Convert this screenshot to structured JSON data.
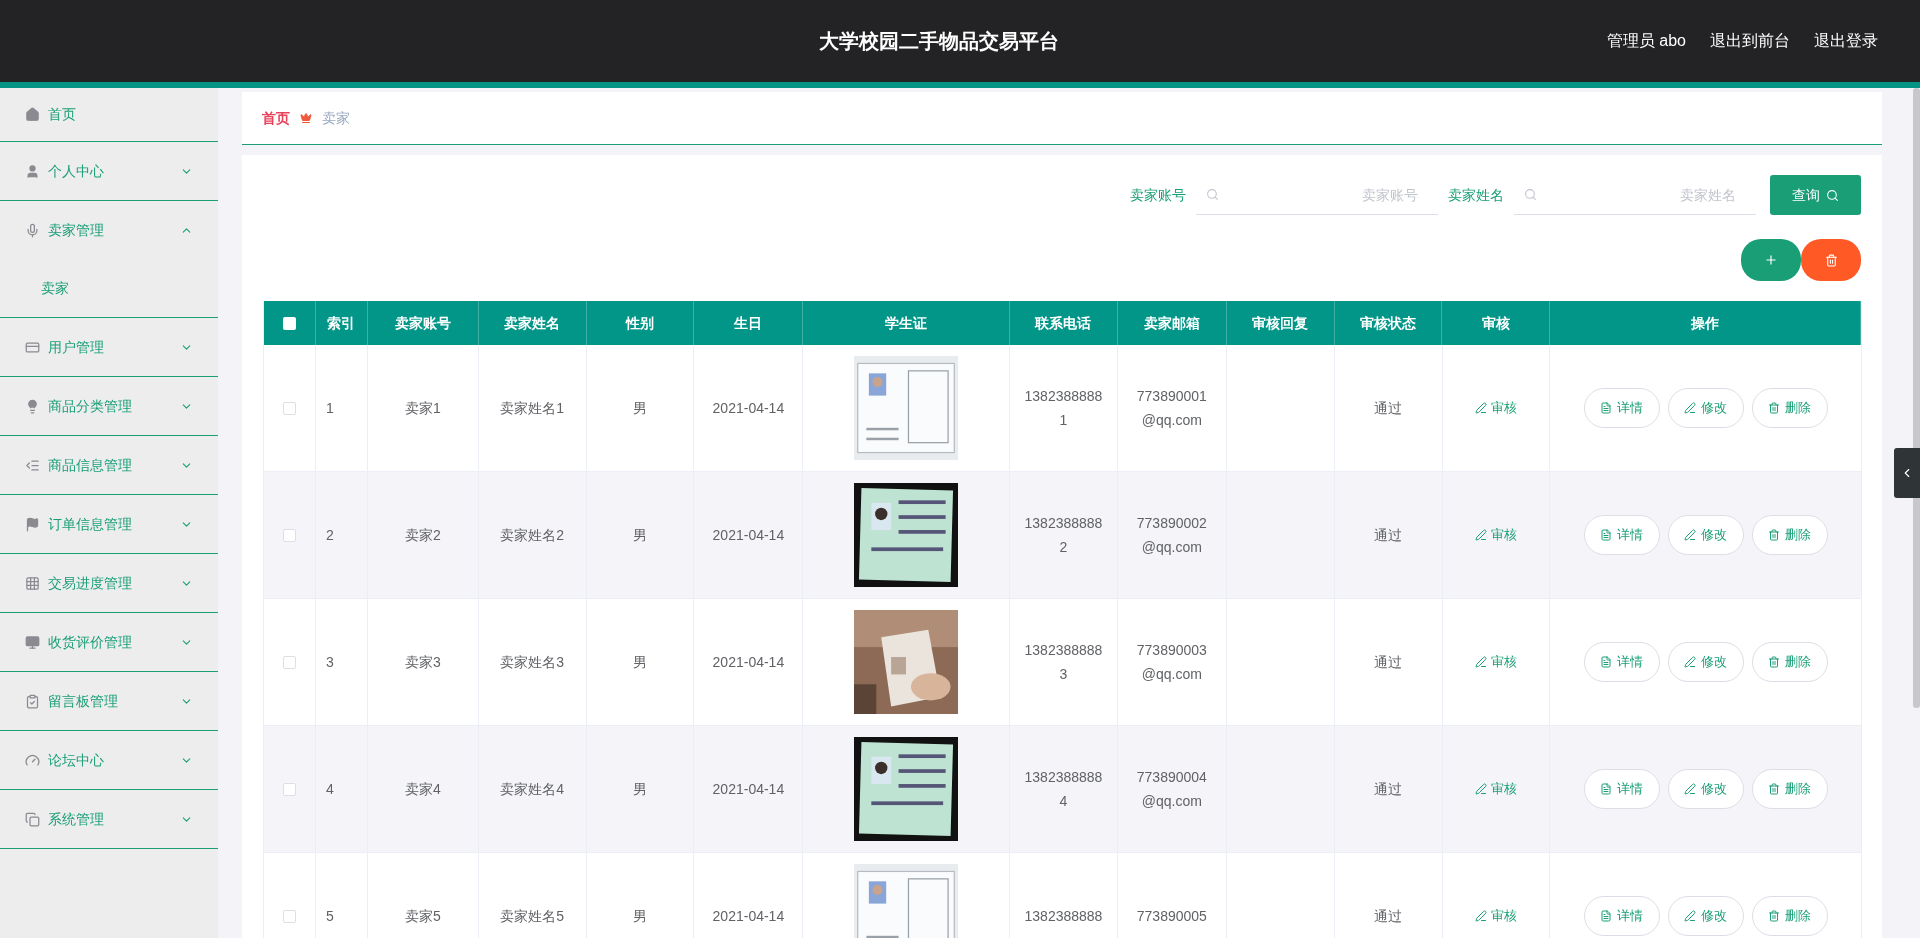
{
  "header": {
    "title": "大学校园二手物品交易平台",
    "user": "管理员 abo",
    "links": [
      "退出到前台",
      "退出登录"
    ]
  },
  "sidebar": {
    "items": [
      {
        "label": "首页",
        "kind": "link"
      },
      {
        "label": "个人中心",
        "kind": "menu",
        "expanded": false
      },
      {
        "label": "卖家管理",
        "kind": "menu",
        "expanded": true,
        "children": [
          {
            "label": "卖家"
          }
        ]
      },
      {
        "label": "用户管理",
        "kind": "menu",
        "expanded": false
      },
      {
        "label": "商品分类管理",
        "kind": "menu",
        "expanded": false
      },
      {
        "label": "商品信息管理",
        "kind": "menu",
        "expanded": false
      },
      {
        "label": "订单信息管理",
        "kind": "menu",
        "expanded": false
      },
      {
        "label": "交易进度管理",
        "kind": "menu",
        "expanded": false
      },
      {
        "label": "收货评价管理",
        "kind": "menu",
        "expanded": false
      },
      {
        "label": "留言板管理",
        "kind": "menu",
        "expanded": false
      },
      {
        "label": "论坛中心",
        "kind": "menu",
        "expanded": false
      },
      {
        "label": "系统管理",
        "kind": "menu",
        "expanded": false
      }
    ]
  },
  "breadcrumb": [
    "首页",
    "卖家"
  ],
  "search": {
    "fields": [
      {
        "label": "卖家账号",
        "placeholder": "卖家账号"
      },
      {
        "label": "卖家姓名",
        "placeholder": "卖家姓名"
      }
    ],
    "button": "查询"
  },
  "table": {
    "select_all": {
      "checked": false
    },
    "columns": [
      "索引",
      "卖家账号",
      "卖家姓名",
      "性别",
      "生日",
      "学生证",
      "联系电话",
      "卖家邮箱",
      "审核回复",
      "审核状态",
      "审核",
      "操作"
    ],
    "rows": [
      {
        "checked": false,
        "index": "1",
        "account": "卖家1",
        "name": "卖家姓名1",
        "gender": "男",
        "birthday": "2021-04-14",
        "phone": "13823888881",
        "email": "773890001@qq.com",
        "status": "通过",
        "review": "审核",
        "actions": [
          "详情",
          "修改",
          "删除"
        ]
      },
      {
        "checked": false,
        "index": "2",
        "account": "卖家2",
        "name": "卖家姓名2",
        "gender": "男",
        "birthday": "2021-04-14",
        "phone": "13823888882",
        "email": "773890002@qq.com",
        "status": "通过",
        "review": "审核",
        "actions": [
          "详情",
          "修改",
          "删除"
        ]
      },
      {
        "checked": false,
        "index": "3",
        "account": "卖家3",
        "name": "卖家姓名3",
        "gender": "男",
        "birthday": "2021-04-14",
        "phone": "13823888883",
        "email": "773890003@qq.com",
        "status": "通过",
        "review": "审核",
        "actions": [
          "详情",
          "修改",
          "删除"
        ]
      },
      {
        "checked": false,
        "index": "4",
        "account": "卖家4",
        "name": "卖家姓名4",
        "gender": "男",
        "birthday": "2021-04-14",
        "phone": "13823888884",
        "email": "773890004@qq.com",
        "status": "通过",
        "review": "审核",
        "actions": [
          "详情",
          "修改",
          "删除"
        ]
      },
      {
        "checked": false,
        "index": "5",
        "account": "卖家5",
        "name": "卖家姓名5",
        "gender": "男",
        "birthday": "2021-04-14",
        "phone": "1382388888",
        "email": "773890005",
        "status": "通过",
        "review": "审核",
        "actions": [
          "详情",
          "修改",
          "删除"
        ]
      }
    ]
  }
}
